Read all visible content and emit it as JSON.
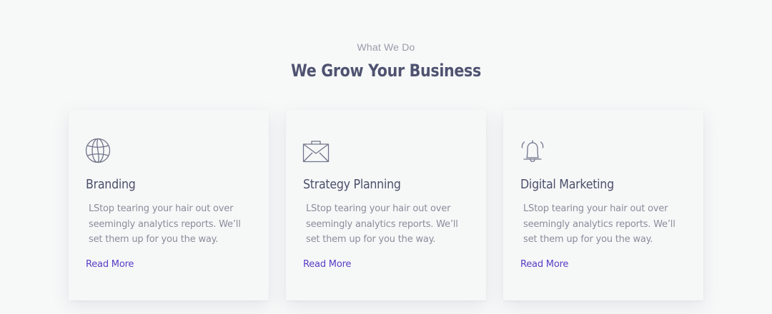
{
  "header": {
    "eyebrow": "What We Do",
    "title": "We Grow Your Business"
  },
  "colors": {
    "background": "#f7f9f9",
    "heading": "#4f5370",
    "body_text": "#8a8c9a",
    "link": "#5a3cc4",
    "icon_stroke": "#707489"
  },
  "cards": [
    {
      "icon": "globe-icon",
      "title": "Branding",
      "body": "LStop tearing your hair out over seemingly analytics reports. We’ll set them up for you the way.",
      "link": "Read More"
    },
    {
      "icon": "briefcase-icon",
      "title": "Strategy Planning",
      "body": "LStop tearing your hair out over seemingly analytics reports. We’ll set them up for you the way.",
      "link": "Read More"
    },
    {
      "icon": "bell-icon",
      "title": "Digital Marketing",
      "body": "LStop tearing your hair out over seemingly analytics reports. We’ll set them up for you the way.",
      "link": "Read More"
    }
  ]
}
